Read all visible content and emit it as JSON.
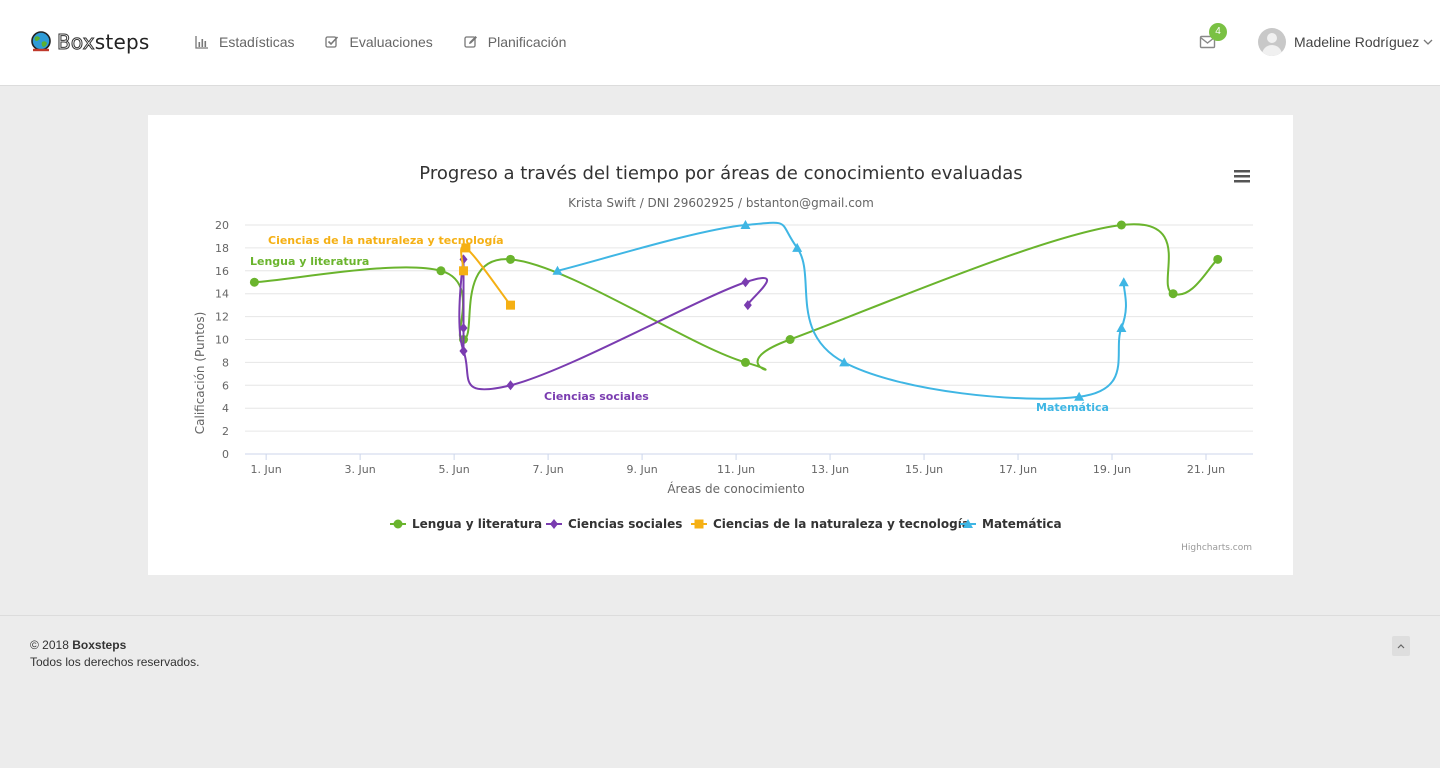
{
  "brand": {
    "prefix": "Box",
    "suffix": "steps"
  },
  "nav": {
    "items": [
      {
        "label": "Estadísticas",
        "icon": "bar-chart-icon"
      },
      {
        "label": "Evaluaciones",
        "icon": "check-square-icon"
      },
      {
        "label": "Planificación",
        "icon": "edit-icon"
      }
    ]
  },
  "header": {
    "mail_count": "4",
    "user_name": "Madeline Rodríguez"
  },
  "colors": {
    "green": "#6ab42d",
    "purple": "#7a3cb0",
    "orange": "#f5b014",
    "blue": "#3fb6e4",
    "badge": "#7ac143"
  },
  "chart_data": {
    "type": "line",
    "title": "Progreso a través del tiempo por áreas de conocimiento evaluadas",
    "subtitle": "Krista Swift / DNI 29602925 / bstanton@gmail.com",
    "xlabel": "Áreas de conocimiento",
    "ylabel": "Calificación (Puntos)",
    "x_ticks": [
      "1. Jun",
      "3. Jun",
      "5. Jun",
      "7. Jun",
      "9. Jun",
      "11. Jun",
      "13. Jun",
      "15. Jun",
      "17. Jun",
      "19. Jun",
      "21. Jun"
    ],
    "x_tick_days": [
      1,
      3,
      5,
      7,
      9,
      11,
      13,
      15,
      17,
      19,
      21
    ],
    "y_ticks": [
      0,
      2,
      4,
      6,
      8,
      10,
      12,
      14,
      16,
      18,
      20
    ],
    "xlim": [
      0.55,
      22.0
    ],
    "ylim": [
      0,
      20
    ],
    "credits": "Highcharts.com",
    "series": [
      {
        "name": "Lengua y literatura",
        "color": "#6ab42d",
        "marker": "circle",
        "x": [
          0.75,
          4.72,
          5.2,
          6.2,
          11.2,
          12.15,
          19.2,
          20.3,
          21.25
        ],
        "y": [
          15,
          16,
          10,
          17,
          8,
          10,
          20,
          14,
          17
        ]
      },
      {
        "name": "Ciencias sociales",
        "color": "#7a3cb0",
        "marker": "diamond",
        "x": [
          5.2,
          5.2,
          5.2,
          5.2,
          6.2,
          11.2,
          11.25
        ],
        "y": [
          11,
          9,
          17,
          9,
          6,
          15,
          13
        ]
      },
      {
        "name": "Ciencias de la naturaleza y tecnología",
        "color": "#f5b014",
        "marker": "square",
        "x": [
          5.2,
          5.25,
          6.2
        ],
        "y": [
          16,
          18,
          13
        ]
      },
      {
        "name": "Matemática",
        "color": "#3fb6e4",
        "marker": "triangle",
        "x": [
          7.2,
          11.2,
          12.3,
          13.3,
          18.3,
          19.2,
          19.25
        ],
        "y": [
          16,
          20,
          18,
          8,
          5,
          11,
          15
        ]
      }
    ]
  },
  "footer": {
    "copyright": "© 2018",
    "brand": "Boxsteps",
    "rights": "Todos los derechos reservados."
  }
}
